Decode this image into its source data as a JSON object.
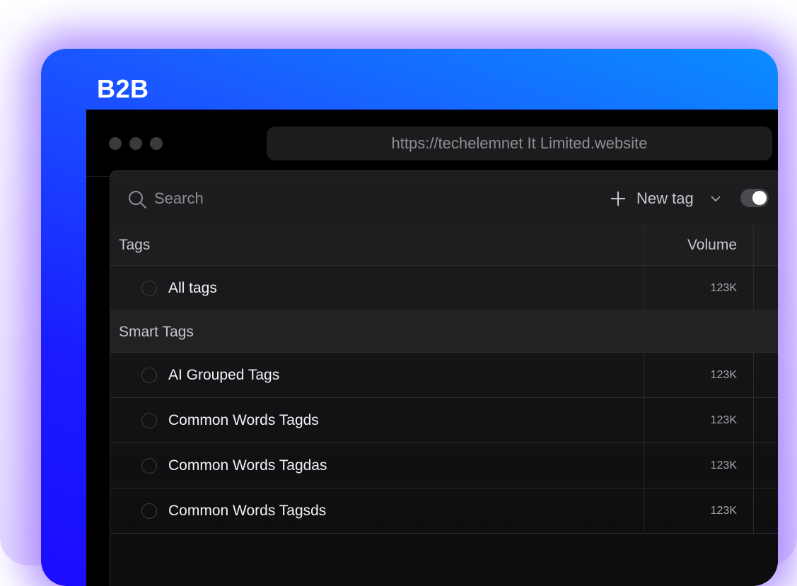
{
  "brand": {
    "title": "B2B"
  },
  "browser": {
    "url": "https://techelemnet It Limited.website"
  },
  "toolbar": {
    "search_placeholder": "Search",
    "new_tag_label": "New tag",
    "toggle_on": true
  },
  "table": {
    "headers": {
      "tags": "Tags",
      "volume": "Volume"
    },
    "all_tags": {
      "label": "All tags",
      "volume": "123K"
    },
    "section_title": "Smart Tags",
    "items": [
      {
        "label": "AI Grouped Tags",
        "volume": "123K"
      },
      {
        "label": "Common Words Tagds",
        "volume": "123K"
      },
      {
        "label": "Common Words Tagdas",
        "volume": "123K"
      },
      {
        "label": "Common Words Tagsds",
        "volume": "123K"
      }
    ]
  },
  "colors": {
    "card_gradient_start": "#0a8dff",
    "card_gradient_end": "#1b0dff",
    "glow": "#9a6eff",
    "panel_bg": "#141416"
  }
}
